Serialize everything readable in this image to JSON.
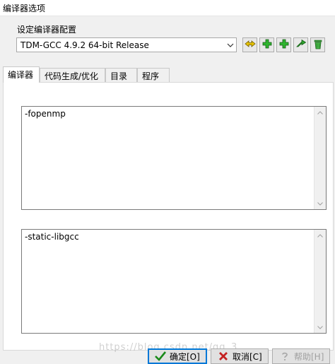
{
  "window": {
    "title": "编译器选项"
  },
  "compiler_set": {
    "label": "设定编译器配置",
    "selected": "TDM-GCC 4.9.2 64-bit Release",
    "buttons": [
      {
        "icon": "rename-icon"
      },
      {
        "icon": "add-icon"
      },
      {
        "icon": "add-from-folder-icon"
      },
      {
        "icon": "find-icon"
      },
      {
        "icon": "delete-icon"
      }
    ]
  },
  "tabs": [
    {
      "label": "编译器",
      "active": true
    },
    {
      "label": "代码生成/优化",
      "active": false
    },
    {
      "label": "目录",
      "active": false
    },
    {
      "label": "程序",
      "active": false
    }
  ],
  "compiler_tab": {
    "compile_commands": "-fopenmp",
    "linker_commands": "-static-libgcc"
  },
  "buttons": {
    "ok": "确定[O]",
    "cancel": "取消[C]",
    "help": "帮助[H]"
  },
  "watermark": "https://blog.csdn.net/qq_3"
}
